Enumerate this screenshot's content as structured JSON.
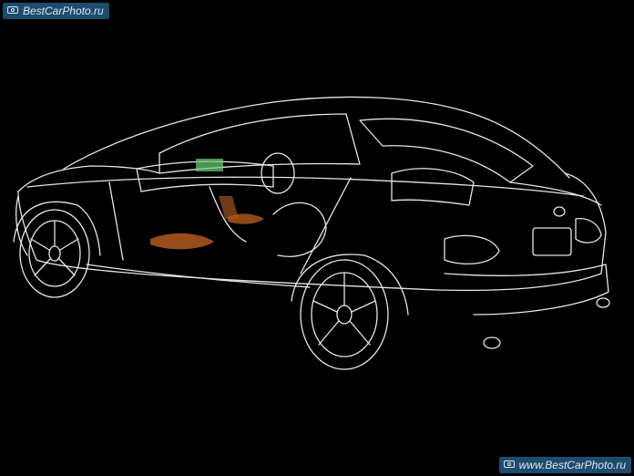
{
  "watermark_top": {
    "text": "BestCarPhoto.ru",
    "icon": "camera-icon"
  },
  "watermark_bottom": {
    "text": "www.BestCarPhoto.ru",
    "icon": "camera-icon"
  },
  "colors": {
    "background": "#000000",
    "outline": "#e6e6e6",
    "interior_accent": "#b05a1e",
    "screen_glow": "#6fd07a",
    "watermark_bg": "#1c4c6e"
  }
}
